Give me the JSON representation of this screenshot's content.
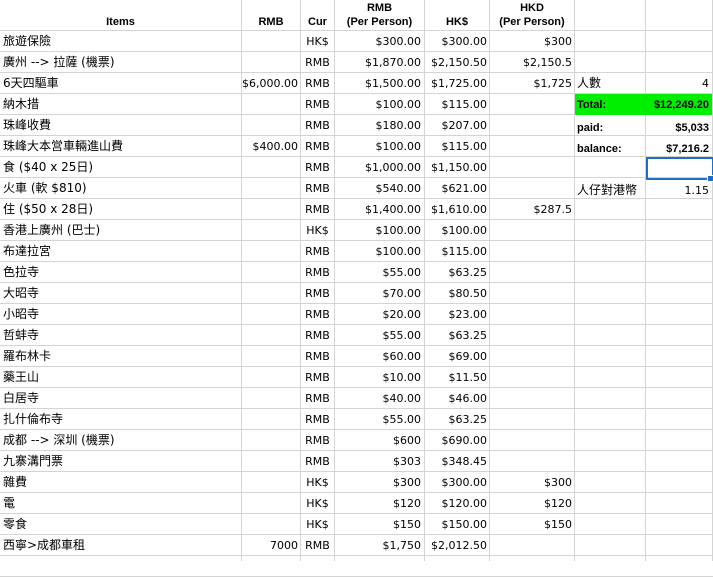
{
  "headers": {
    "items": "Items",
    "rmb": "RMB",
    "cur": "Cur",
    "rmb_pp_line1": "RMB",
    "rmb_pp_line2": "(Per Person)",
    "hkd": "HK$",
    "hkd_pp_line1": "HKD",
    "hkd_pp_line2": "(Per Person)"
  },
  "rows": [
    {
      "item": "旅遊保險",
      "rmb": "",
      "cur": "HK$",
      "rmb_pp": "$300.00",
      "hk": "$300.00",
      "hkd_pp": "$300"
    },
    {
      "item": "廣州 --> 拉薩 (機票)",
      "rmb": "",
      "cur": "RMB",
      "rmb_pp": "$1,870.00",
      "hk": "$2,150.50",
      "hkd_pp": "$2,150.5"
    },
    {
      "item": "6天四驅車",
      "rmb": "$6,000.00",
      "cur": "RMB",
      "rmb_pp": "$1,500.00",
      "hk": "$1,725.00",
      "hkd_pp": "$1,725"
    },
    {
      "item": "納木措",
      "rmb": "",
      "cur": "RMB",
      "rmb_pp": "$100.00",
      "hk": "$115.00",
      "hkd_pp": ""
    },
    {
      "item": "珠峰收費",
      "rmb": "",
      "cur": "RMB",
      "rmb_pp": "$180.00",
      "hk": "$207.00",
      "hkd_pp": ""
    },
    {
      "item": "珠峰大本営車輛進山費",
      "rmb": "$400.00",
      "cur": "RMB",
      "rmb_pp": "$100.00",
      "hk": "$115.00",
      "hkd_pp": ""
    },
    {
      "item": "食 ($40 x 25日)",
      "rmb": "",
      "cur": "RMB",
      "rmb_pp": "$1,000.00",
      "hk": "$1,150.00",
      "hkd_pp": ""
    },
    {
      "item": "火車 (軟 $810)",
      "rmb": "",
      "cur": "RMB",
      "rmb_pp": "$540.00",
      "hk": "$621.00",
      "hkd_pp": ""
    },
    {
      "item": "住 ($50 x 28日)",
      "rmb": "",
      "cur": "RMB",
      "rmb_pp": "$1,400.00",
      "hk": "$1,610.00",
      "hkd_pp": "$287.5"
    },
    {
      "item": "香港上廣州 (巴士)",
      "rmb": "",
      "cur": "HK$",
      "rmb_pp": "$100.00",
      "hk": "$100.00",
      "hkd_pp": ""
    },
    {
      "item": "布達拉宮",
      "rmb": "",
      "cur": "RMB",
      "rmb_pp": "$100.00",
      "hk": "$115.00",
      "hkd_pp": ""
    },
    {
      "item": "色拉寺",
      "rmb": "",
      "cur": "RMB",
      "rmb_pp": "$55.00",
      "hk": "$63.25",
      "hkd_pp": ""
    },
    {
      "item": "大昭寺",
      "rmb": "",
      "cur": "RMB",
      "rmb_pp": "$70.00",
      "hk": "$80.50",
      "hkd_pp": ""
    },
    {
      "item": "小昭寺",
      "rmb": "",
      "cur": "RMB",
      "rmb_pp": "$20.00",
      "hk": "$23.00",
      "hkd_pp": ""
    },
    {
      "item": "哲蚌寺",
      "rmb": "",
      "cur": "RMB",
      "rmb_pp": "$55.00",
      "hk": "$63.25",
      "hkd_pp": ""
    },
    {
      "item": "羅布林卡",
      "rmb": "",
      "cur": "RMB",
      "rmb_pp": "$60.00",
      "hk": "$69.00",
      "hkd_pp": ""
    },
    {
      "item": "藥王山",
      "rmb": "",
      "cur": "RMB",
      "rmb_pp": "$10.00",
      "hk": "$11.50",
      "hkd_pp": ""
    },
    {
      "item": "白居寺",
      "rmb": "",
      "cur": "RMB",
      "rmb_pp": "$40.00",
      "hk": "$46.00",
      "hkd_pp": ""
    },
    {
      "item": "扎什倫布寺",
      "rmb": "",
      "cur": "RMB",
      "rmb_pp": "$55.00",
      "hk": "$63.25",
      "hkd_pp": ""
    },
    {
      "item": "成都 --> 深圳 (機票)",
      "rmb": "",
      "cur": "RMB",
      "rmb_pp": "$600",
      "hk": "$690.00",
      "hkd_pp": ""
    },
    {
      "item": "九寨溝門票",
      "rmb": "",
      "cur": "RMB",
      "rmb_pp": "$303",
      "hk": "$348.45",
      "hkd_pp": ""
    },
    {
      "item": "雜費",
      "rmb": "",
      "cur": "HK$",
      "rmb_pp": "$300",
      "hk": "$300.00",
      "hkd_pp": "$300"
    },
    {
      "item": "電",
      "rmb": "",
      "cur": "HK$",
      "rmb_pp": "$120",
      "hk": "$120.00",
      "hkd_pp": "$120"
    },
    {
      "item": "零食",
      "rmb": "",
      "cur": "HK$",
      "rmb_pp": "$150",
      "hk": "$150.00",
      "hkd_pp": "$150"
    },
    {
      "item": "西寧>成都車租",
      "rmb": "7000",
      "cur": "RMB",
      "rmb_pp": "$1,750",
      "hk": "$2,012.50",
      "hkd_pp": ""
    }
  ],
  "summary": {
    "people_label": "人數",
    "people_value": "4",
    "total_label": "Total:",
    "total_value": "$12,249.20",
    "total_fill_color": "#00ef00",
    "paid_label": "paid:",
    "paid_value": "$5,033",
    "balance_label": "balance:",
    "balance_value": "$7,216.2",
    "rate_label": "人仔對港幣",
    "rate_value": "1.15"
  },
  "colors": {
    "gridline": "#d4d4d4",
    "selection": "#1e6dc8"
  }
}
